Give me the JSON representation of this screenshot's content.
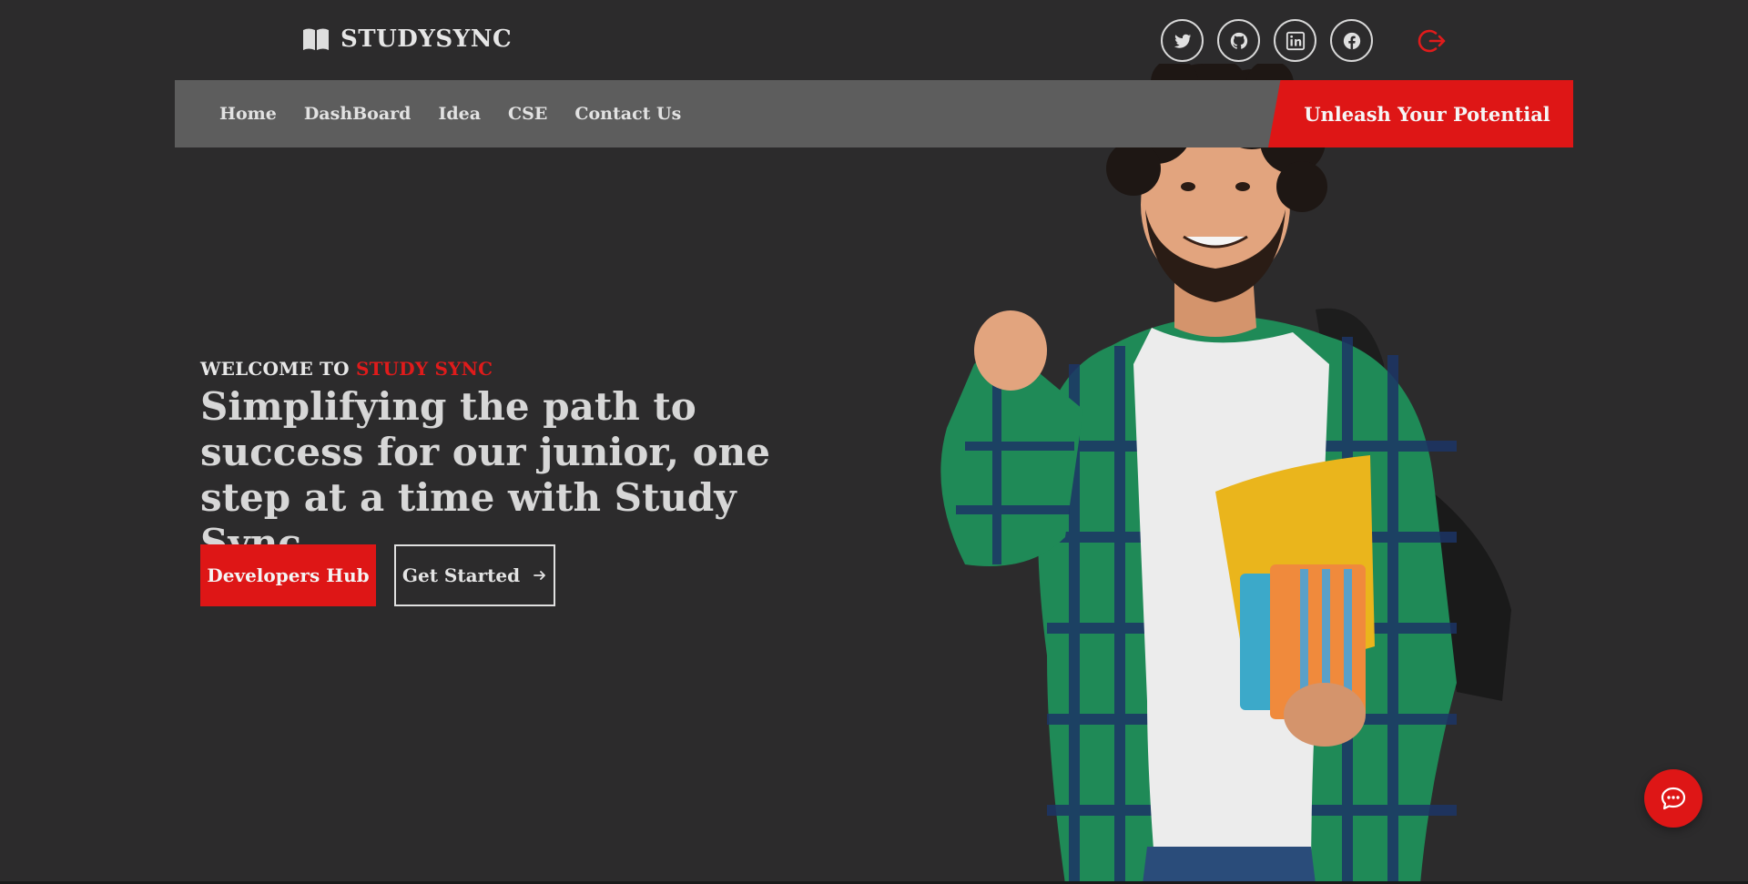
{
  "header": {
    "brand_name": "STUDYSYNC",
    "brand_icon": "book-open-icon",
    "social_links": [
      {
        "name": "twitter",
        "icon": "twitter-icon"
      },
      {
        "name": "github",
        "icon": "github-icon"
      },
      {
        "name": "linkedin",
        "icon": "linkedin-icon"
      },
      {
        "name": "facebook",
        "icon": "facebook-icon"
      }
    ],
    "logout_icon": "logout-icon"
  },
  "nav": {
    "items": [
      "Home",
      "DashBoard",
      "Idea",
      "CSE",
      "Contact Us"
    ],
    "cta_label": "Unleash Your Potential"
  },
  "hero": {
    "welcome_prefix": "WELCOME TO",
    "welcome_accent": "STUDY SYNC",
    "headline": "Simplifying the path to success for our junior, one step at a time with Study Sync",
    "primary_button": "Developers Hub",
    "secondary_button": "Get Started",
    "secondary_button_icon": "arrow-right-icon",
    "image": "student-with-books-photo"
  },
  "chat": {
    "icon": "chat-bubble-icon"
  },
  "colors": {
    "background": "#2c2b2c",
    "navbar": "#5d5d5d",
    "accent": "#de1616",
    "text": "#dcdcdc"
  }
}
